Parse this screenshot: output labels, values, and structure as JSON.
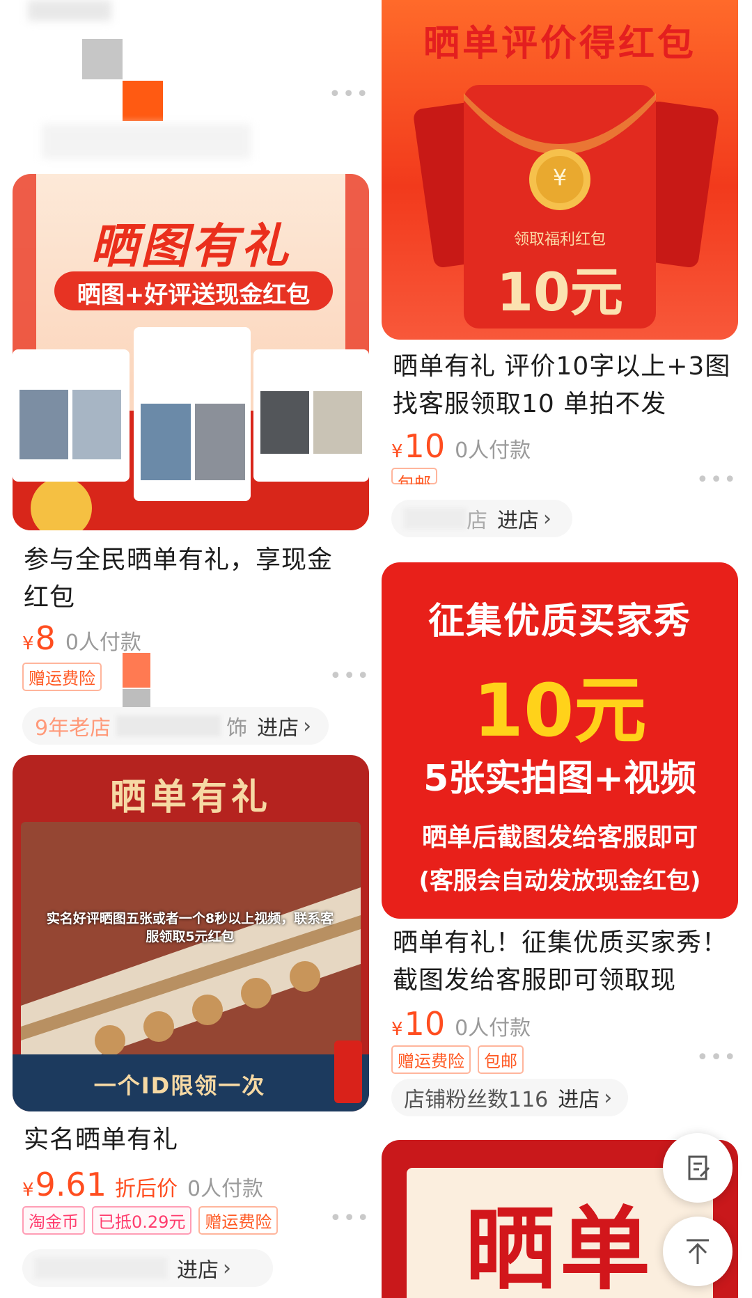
{
  "left_col": {
    "top_partial": {
      "more_icon": "more-dots-icon"
    },
    "card1": {
      "banner_title": "晒图有礼",
      "banner_sub": "晒图+好评送现金红包",
      "title": "参与全民晒单有礼，享现金红包",
      "currency": "¥",
      "price": "8",
      "buyers": "0人付款",
      "tags": [
        "赠运费险"
      ],
      "shop_age": "9年老店",
      "shop_name_tail": "饰",
      "enter": "进店"
    },
    "card2": {
      "banner_title": "晒单有礼",
      "caption": "实名好评晒图五张或者一个8秒以上视频，联系客服领取5元红包",
      "limit": "一个ID限领一次",
      "title": "实名晒单有礼",
      "currency": "¥",
      "price": "9.61",
      "discount": "折后价",
      "buyers": "0人付款",
      "tags": [
        "淘金币",
        "已抵0.29元",
        "赠运费险"
      ],
      "enter": "进店"
    }
  },
  "right_col": {
    "card1": {
      "banner_title": "晒单评价得红包",
      "envelope_label": "领取福利红包",
      "envelope_amount": "10元",
      "title": "晒单有礼 评价10字以上+3图 找客服领取10 单拍不发",
      "currency": "¥",
      "price": "10",
      "buyers": "0人付款",
      "tags": [
        "包邮"
      ],
      "shop_name_tail": "店",
      "enter": "进店"
    },
    "card2": {
      "line1": "征集优质买家秀",
      "line2": "10元",
      "line3": "5张实拍图+视频",
      "line4": "晒单后截图发给客服即可",
      "line5": "(客服会自动发放现金红包)",
      "title": "晒单有礼！征集优质买家秀！截图发给客服即可领取现",
      "currency": "¥",
      "price": "10",
      "buyers": "0人付款",
      "tags": [
        "赠运费险",
        "包邮"
      ],
      "shop": "店铺粉丝数116",
      "enter": "进店"
    },
    "card3": {
      "banner_text": "晒单"
    }
  },
  "colors": {
    "accent": "#ff4d1f",
    "banner_red": "#e8201a",
    "yellow": "#ffd21a"
  }
}
